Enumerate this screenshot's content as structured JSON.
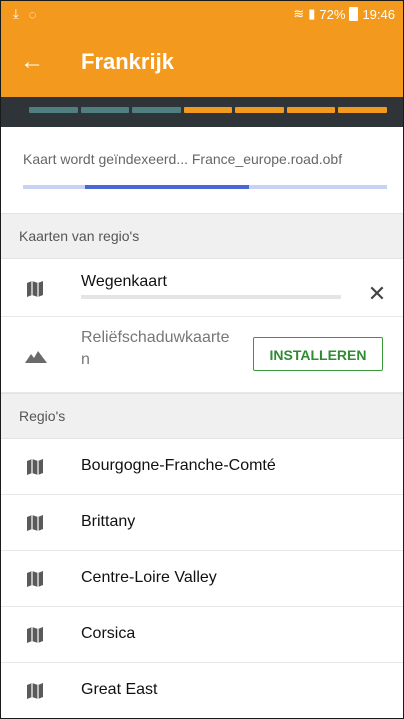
{
  "status_bar": {
    "left_icons": [
      "download-icon",
      "cast-icon"
    ],
    "battery": "72%",
    "time": "19:46"
  },
  "toolbar": {
    "title": "Frankrijk",
    "back_icon": "arrow-left-icon"
  },
  "download_bar": {
    "segments": [
      "done",
      "done",
      "done",
      "active",
      "active",
      "active",
      "active"
    ],
    "colors": {
      "done": "#4f7f80",
      "active": "#f39a1e"
    }
  },
  "indexing": {
    "text": "Kaart wordt geïndexeerd... France_europe.road.obf",
    "progress": 0.45
  },
  "maps_section": {
    "header": "Kaarten van regio's",
    "items": [
      {
        "label": "Wegenkaart",
        "icon": "map-icon",
        "action_icon": "close-icon"
      },
      {
        "label_line1": "Reliëfschaduwkaarte",
        "label_line2": "n",
        "icon": "mountain-icon",
        "button": "INSTALLEREN"
      }
    ]
  },
  "regions_section": {
    "header": "Regio's",
    "items": [
      {
        "label": "Bourgogne-Franche-Comté"
      },
      {
        "label": "Brittany"
      },
      {
        "label": "Centre-Loire Valley"
      },
      {
        "label": "Corsica"
      },
      {
        "label": "Great East"
      }
    ]
  },
  "colors": {
    "accent": "#f39a1e",
    "install_green": "#2f8c32",
    "progress_blue": "#4a67d8"
  }
}
